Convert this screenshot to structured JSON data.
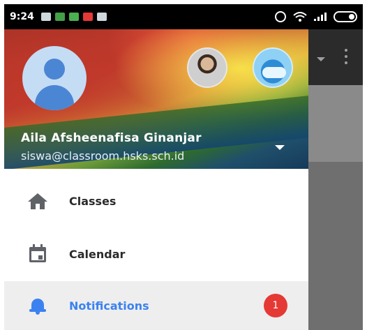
{
  "status_bar": {
    "time": "9:24",
    "notification_icons": [
      "message-icon",
      "classroom-icon",
      "download-icon",
      "gmail-icon",
      "message-icon"
    ],
    "right_icons": [
      "alarm-icon",
      "wifi-icon",
      "signal-icon",
      "battery-icon"
    ]
  },
  "drawer": {
    "account": {
      "name": "Aila Afsheenafisa Ginanjar",
      "email": "siswa@classroom.hsks.sch.id"
    },
    "items": [
      {
        "label": "Classes",
        "icon": "home-icon"
      },
      {
        "label": "Calendar",
        "icon": "calendar-icon"
      },
      {
        "label": "Notifications",
        "icon": "bell-icon",
        "badge": "1",
        "selected": true
      }
    ]
  },
  "colors": {
    "accent": "#3b82f0",
    "badge": "#e53935",
    "selected_bg": "#eeeeee"
  }
}
